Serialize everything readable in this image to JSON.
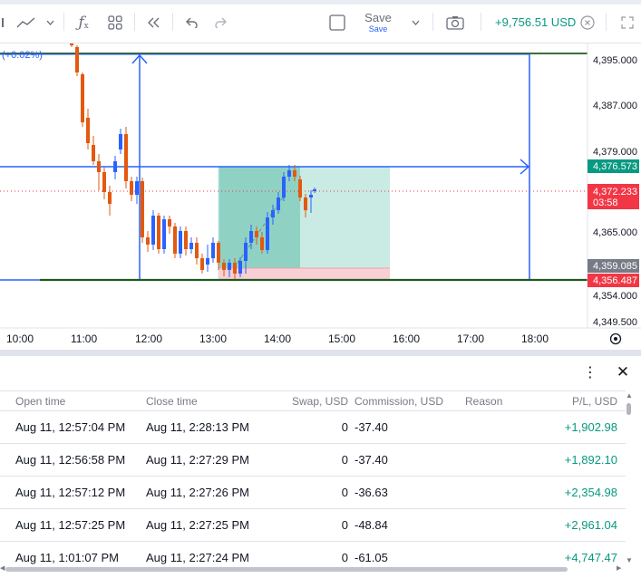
{
  "toolbar": {
    "save_label": "Save",
    "save_sub": "Save",
    "pnl": "+9,756.51 USD",
    "icons": [
      "line-chart-icon",
      "chevron-down-icon",
      "fx-indicators-icon",
      "templates-grid-icon",
      "rewind-icon",
      "undo-icon",
      "redo-icon",
      "layout-square-icon",
      "chevron-down-icon",
      "camera-icon",
      "close-circle-icon",
      "fullscreen-icon"
    ]
  },
  "chart": {
    "change_label": "(+0.02%)",
    "price_axis": [
      "4,395.000",
      "4,387.000",
      "4,379.000",
      "4,365.000",
      "4,354.000",
      "4,349.500"
    ],
    "price_badges": [
      {
        "label": "4,376.573",
        "color": "#089981"
      },
      {
        "label": "4,372.233",
        "sub": "03:58",
        "color": "#f23645"
      },
      {
        "label": "4,359.085",
        "color": "#787b86"
      },
      {
        "label": "4,356.487",
        "color": "#f23645"
      }
    ],
    "time_axis": [
      "10:00",
      "11:00",
      "12:00",
      "13:00",
      "14:00",
      "15:00",
      "16:00",
      "17:00",
      "18:00"
    ],
    "colors": {
      "up": "#2962ff",
      "down": "#e2590f",
      "target_zone": "#b3e3d8",
      "stop_zone": "#f8cfd4",
      "horizontal_line": "#1e5a1e",
      "arrow_line": "#2962ff"
    }
  },
  "panel": {
    "more_icon": "more-vertical-icon",
    "close_icon": "close-icon",
    "columns": [
      "Open time",
      "Close time",
      "Swap, USD",
      "Commission, USD",
      "Reason",
      "P/L, USD"
    ],
    "rows": [
      {
        "open": "Aug 11, 12:57:04 PM",
        "close": "Aug 11, 2:28:13 PM",
        "swap": "0",
        "commission": "-37.40",
        "reason": "",
        "pl": "+1,902.98"
      },
      {
        "open": "Aug 11, 12:56:58 PM",
        "close": "Aug 11, 2:27:29 PM",
        "swap": "0",
        "commission": "-37.40",
        "reason": "",
        "pl": "+1,892.10"
      },
      {
        "open": "Aug 11, 12:57:12 PM",
        "close": "Aug 11, 2:27:26 PM",
        "swap": "0",
        "commission": "-36.63",
        "reason": "",
        "pl": "+2,354.98"
      },
      {
        "open": "Aug 11, 12:57:25 PM",
        "close": "Aug 11, 2:27:25 PM",
        "swap": "0",
        "commission": "-48.84",
        "reason": "",
        "pl": "+2,961.04"
      },
      {
        "open": "Aug 11, 1:01:07 PM",
        "close": "Aug 11, 2:27:24 PM",
        "swap": "0",
        "commission": "-61.05",
        "reason": "",
        "pl": "+4,747.47"
      }
    ]
  }
}
